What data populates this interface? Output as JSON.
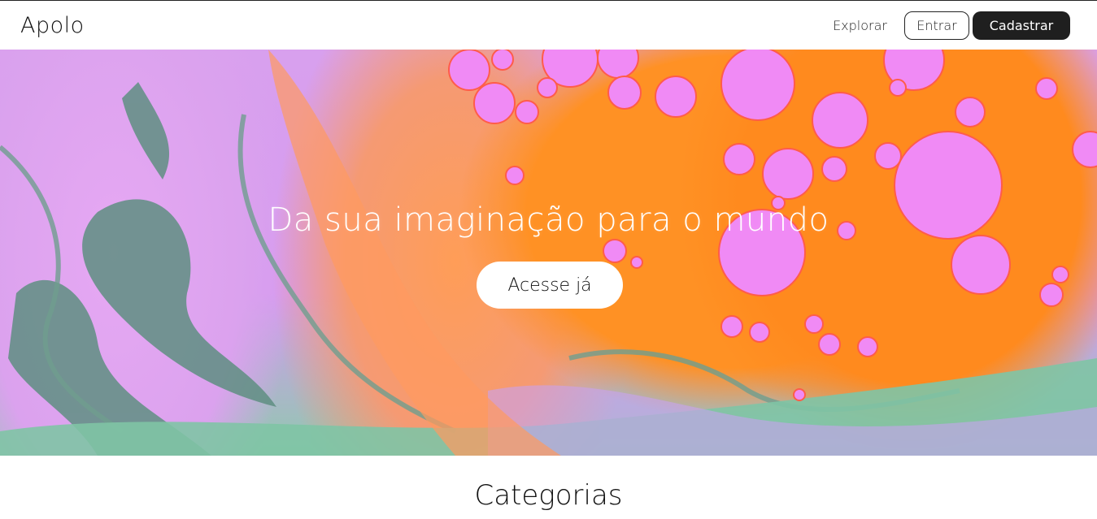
{
  "header": {
    "brand": "Apolo",
    "nav": {
      "explore_label": "Explorar",
      "login_label": "Entrar",
      "signup_label": "Cadastrar"
    }
  },
  "hero": {
    "title": "Da sua imaginação para o mundo",
    "cta_label": "Acesse já",
    "colors": {
      "orange": "#ff8a1e",
      "pink_bubble": "#f08af5",
      "lilac": "#d9a2ef",
      "teal": "#5f9f8a"
    }
  },
  "sections": {
    "categories_title": "Categorias"
  }
}
